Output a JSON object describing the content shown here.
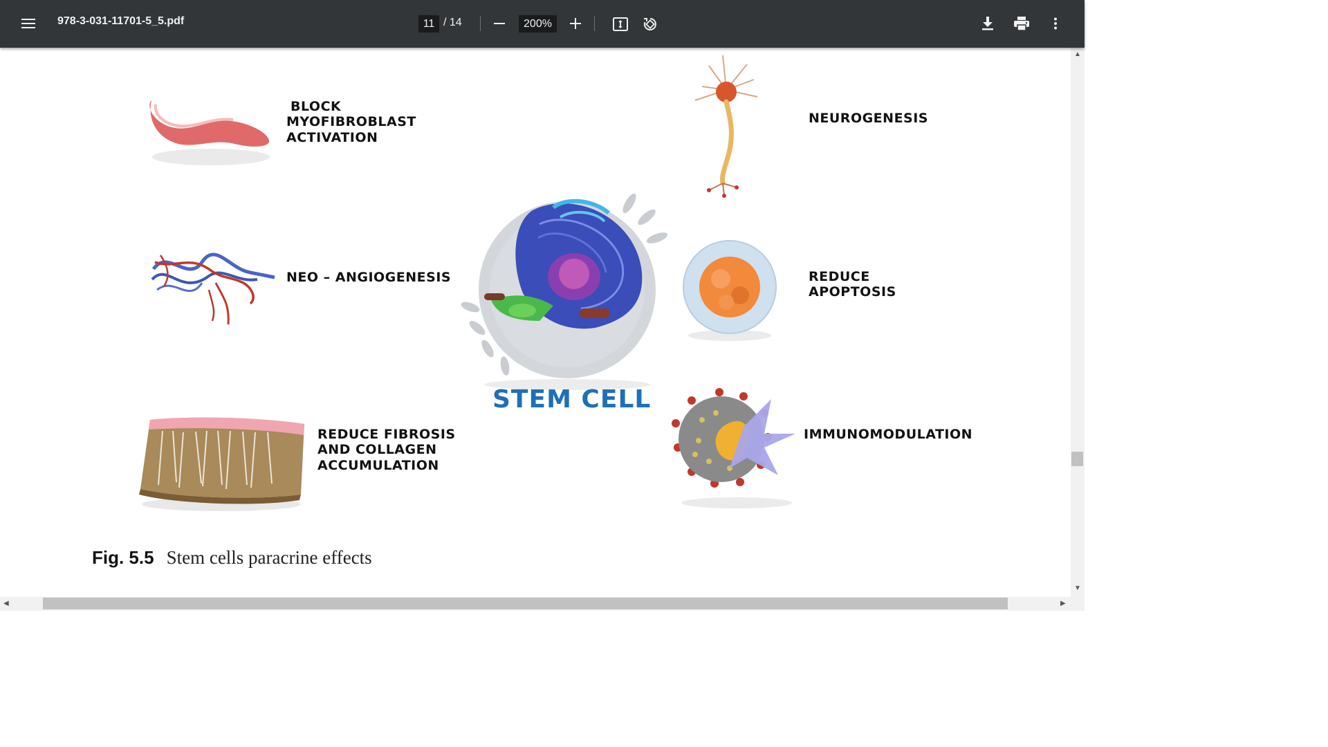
{
  "toolbar": {
    "menu_icon": "hamburger-menu-icon",
    "title": "978-3-031-11701-5_5.pdf",
    "current_page": "11",
    "page_total": "/ 14",
    "zoom": "200%",
    "zoom_out_icon": "minus-icon",
    "zoom_in_icon": "plus-icon",
    "fit_icon": "fit-to-page-icon",
    "rotate_icon": "rotate-icon",
    "download_icon": "download-icon",
    "print_icon": "print-icon",
    "more_icon": "more-vert-icon"
  },
  "figure": {
    "center_label": "STEM CELL",
    "labels": {
      "block_1": "BLOCK",
      "block_2": "MYOFIBROBLAST",
      "block_3": "ACTIVATION",
      "neo": "NEO – ANGIOGENESIS",
      "fibrosis_1": "REDUCE FIBROSIS",
      "fibrosis_2": "AND COLLAGEN",
      "fibrosis_3": "ACCUMULATION",
      "neuro": "NEUROGENESIS",
      "apop_1": "REDUCE",
      "apop_2": "APOPTOSIS",
      "immuno": "IMMUNOMODULATION"
    },
    "caption_num": "Fig. 5.5",
    "caption_text": "Stem cells paracrine effects"
  },
  "colors": {
    "toolbar_bg": "#323639",
    "stem_label": "#1f6fb8"
  }
}
